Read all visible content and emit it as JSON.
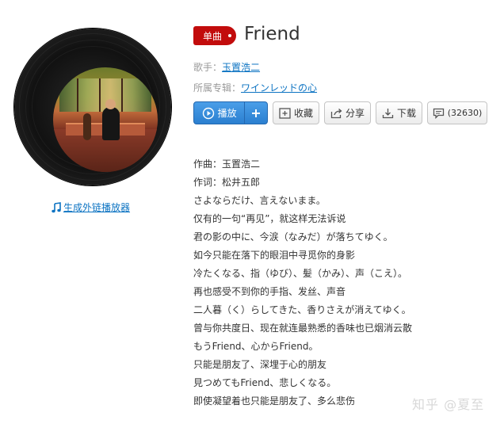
{
  "song": {
    "badge": "单曲",
    "title": "Friend",
    "singer_label": "歌手：",
    "singer": "玉置浩二",
    "album_label": "所属专辑：",
    "album": "ワインレッドの心"
  },
  "player_link": "生成外链播放器",
  "buttons": {
    "play": "播放",
    "add_icon": "plus-icon",
    "favorite": "收藏",
    "share": "分享",
    "download": "下载",
    "comment_count": "(32630)"
  },
  "lyrics": [
    "作曲：玉置浩二",
    "作词：松井五郎",
    "さよならだけ、言えないまま。",
    "仅有的一句“再见”，就这样无法诉说",
    "君の影の中に、今涙（なみだ）が落ちてゆく。",
    "如今只能在落下的眼泪中寻觅你的身影",
    "冷たくなる、指（ゆび）、髪（かみ）、声（こえ）。",
    "再也感受不到你的手指、发丝、声音",
    "二人暮（く）らしてきた、香りさえが消えてゆく。",
    "曾与你共度日、现在就连最熟悉的香味也已烟消云散",
    "もうFriend、心からFriend。",
    "只能是朋友了、深埋于心的朋友",
    "見つめてもFriend、悲しくなる。",
    "即使凝望着也只能是朋友了、多么悲伤"
  ],
  "watermark": "知乎 @夏至",
  "colors": {
    "badge_red": "#c20c0c",
    "play_blue": "#2b7fd0",
    "link_blue": "#0c73c2"
  }
}
